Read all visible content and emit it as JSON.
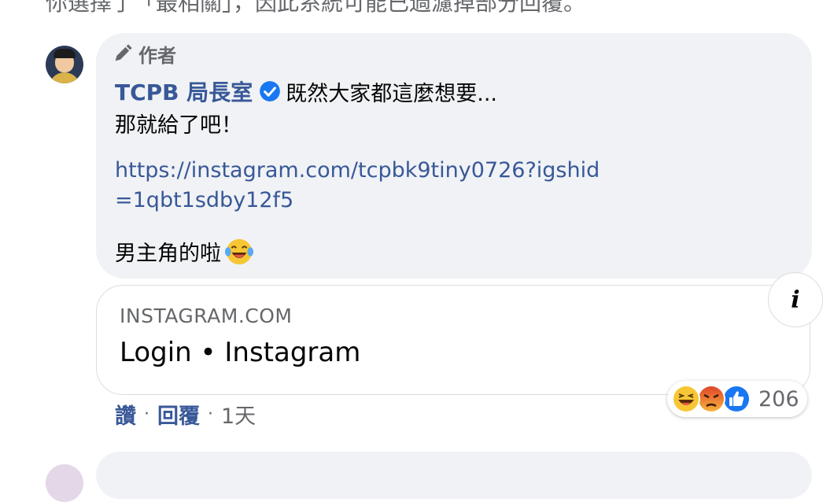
{
  "top_notice": "你選擇了「最相關」，因此系統可能已過濾掉部分回覆。",
  "comment": {
    "author_badge": "作者",
    "author_name": "TCPB 局長室",
    "first_line": "既然大家都這麼想要...",
    "second_line": "那就給了吧！",
    "link": "https://instagram.com/tcpbk9tiny0726?igshid=1qbt1sdby12f5",
    "last_line": "男主角的啦",
    "icons": {
      "badge": "pencil-icon",
      "verified": "verified-icon",
      "emoji": "laughing-tears-emoji"
    }
  },
  "link_preview": {
    "domain": "INSTAGRAM.COM",
    "title": "Login • Instagram",
    "info_icon": "i"
  },
  "actions": {
    "like": "讚",
    "reply": "回覆",
    "time": "1天",
    "separator": "·"
  },
  "reactions": {
    "types": [
      "haha",
      "angry",
      "like"
    ],
    "count": "206"
  },
  "colors": {
    "link": "#385898",
    "bubble": "#f0f2f5",
    "secondary_text": "#65676b",
    "verified": "#1877f2"
  }
}
